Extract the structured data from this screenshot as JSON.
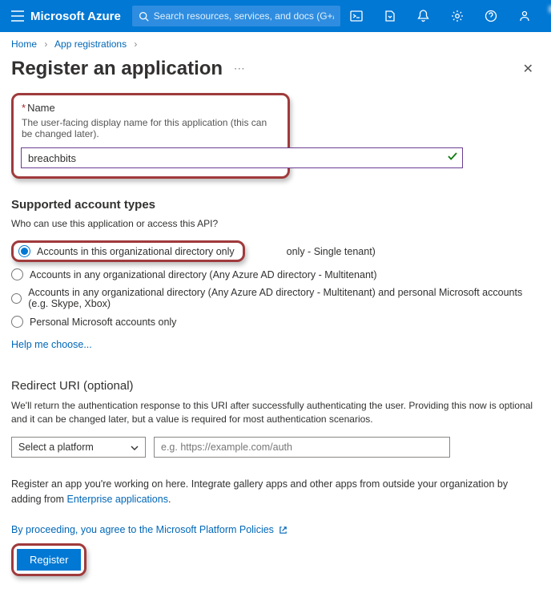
{
  "header": {
    "brand": "Microsoft Azure",
    "search_placeholder": "Search resources, services, and docs (G+/)"
  },
  "breadcrumb": {
    "home": "Home",
    "apps": "App registrations"
  },
  "page": {
    "title": "Register an application"
  },
  "name_section": {
    "label": "Name",
    "help": "The user-facing display name for this application (this can be changed later).",
    "value": "breachbits"
  },
  "accounts": {
    "title": "Supported account types",
    "question": "Who can use this application or access this API?",
    "opt1_a": "Accounts in this organizational directory only",
    "opt1_suffix": "only - Single tenant)",
    "opt2": "Accounts in any organizational directory (Any Azure AD directory - Multitenant)",
    "opt3": "Accounts in any organizational directory (Any Azure AD directory - Multitenant) and personal Microsoft accounts (e.g. Skype, Xbox)",
    "opt4": "Personal Microsoft accounts only",
    "help_link": "Help me choose..."
  },
  "redirect": {
    "title": "Redirect URI (optional)",
    "desc": "We'll return the authentication response to this URI after successfully authenticating the user. Providing this now is optional and it can be changed later, but a value is required for most authentication scenarios.",
    "select_label": "Select a platform",
    "uri_placeholder": "e.g. https://example.com/auth"
  },
  "integrate": {
    "text": "Register an app you're working on here. Integrate gallery apps and other apps from outside your organization by adding from ",
    "link": "Enterprise applications"
  },
  "policy": {
    "text": "By proceeding, you agree to the Microsoft Platform Policies"
  },
  "actions": {
    "register": "Register"
  }
}
